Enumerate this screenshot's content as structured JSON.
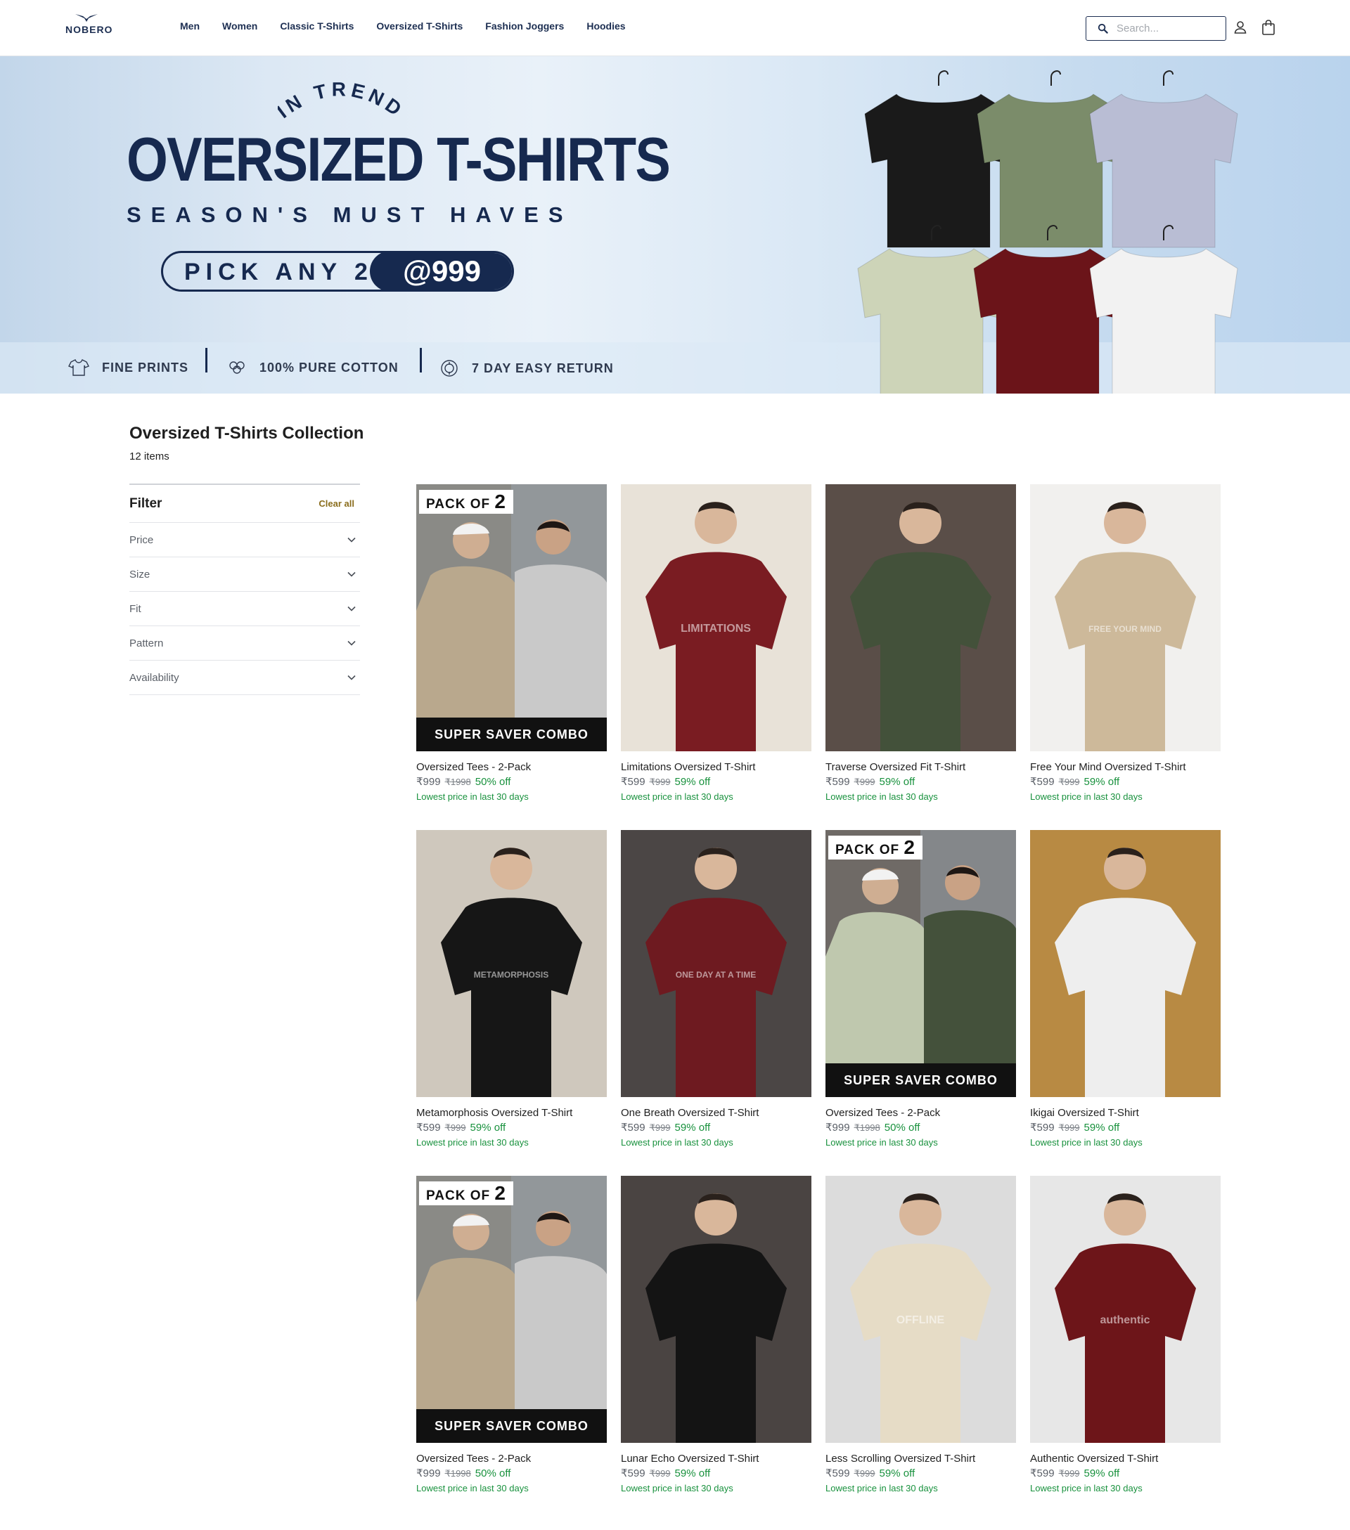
{
  "header": {
    "logo_text": "NOBERO",
    "nav": [
      "Men",
      "Women",
      "Classic T-Shirts",
      "Oversized T-Shirts",
      "Fashion Joggers",
      "Hoodies"
    ],
    "search_placeholder": "Search...",
    "icons": [
      "search-icon",
      "user-icon",
      "bag-icon"
    ]
  },
  "hero": {
    "kicker": "IN TREND",
    "title": "OVERSIZED T-SHIRTS",
    "subtitle": "SEASON'S MUST HAVES",
    "offer_left": "PICK ANY 2",
    "offer_right": "@999",
    "features": [
      "FINE PRINTS",
      "100% PURE COTTON",
      "7 DAY EASY RETURN"
    ],
    "shirt_colors": [
      "#1a1a1a",
      "#7b8c6a",
      "#b9bdd4",
      "#cdd4b8",
      "#6b1419",
      "#f2f2f2"
    ]
  },
  "collection": {
    "title": "Oversized T-Shirts Collection",
    "count": "12 items"
  },
  "filter": {
    "title": "Filter",
    "clear": "Clear all",
    "items": [
      "Price",
      "Size",
      "Fit",
      "Pattern",
      "Availability"
    ]
  },
  "products": [
    {
      "name": "Oversized Tees - 2-Pack",
      "price": "₹999",
      "mrp": "₹1998",
      "off": "50% off",
      "note": "Lowest price in last 30 days",
      "pack": true,
      "combo": "SUPER SAVER COMBO",
      "badge": "PACK OF",
      "badge_num": "2",
      "colors": [
        "#b9a88d",
        "#c9c9c9"
      ],
      "bg": "#8a8a86"
    },
    {
      "name": "Limitations Oversized T-Shirt",
      "price": "₹599",
      "mrp": "₹999",
      "off": "59% off",
      "note": "Lowest price in last 30 days",
      "shirt": "#7a1c22",
      "bg": "#e8e2d8",
      "print": "LIMITATIONS"
    },
    {
      "name": "Traverse Oversized Fit T-Shirt",
      "price": "₹599",
      "mrp": "₹999",
      "off": "59% off",
      "note": "Lowest price in last 30 days",
      "shirt": "#43513a",
      "bg": "#5a4e48"
    },
    {
      "name": "Free Your Mind Oversized T-Shirt",
      "price": "₹599",
      "mrp": "₹999",
      "off": "59% off",
      "note": "Lowest price in last 30 days",
      "shirt": "#cdb99a",
      "bg": "#f1f0ee",
      "print": "FREE YOUR MIND"
    },
    {
      "name": "Metamorphosis Oversized T-Shirt",
      "price": "₹599",
      "mrp": "₹999",
      "off": "59% off",
      "note": "Lowest price in last 30 days",
      "shirt": "#161616",
      "bg": "#cfc8bd",
      "print": "METAMORPHOSIS"
    },
    {
      "name": "One Breath Oversized T-Shirt",
      "price": "₹599",
      "mrp": "₹999",
      "off": "59% off",
      "note": "Lowest price in last 30 days",
      "shirt": "#6e1a20",
      "bg": "#4b4645",
      "print": "ONE DAY AT A TIME"
    },
    {
      "name": "Oversized Tees - 2-Pack",
      "price": "₹999",
      "mrp": "₹1998",
      "off": "50% off",
      "note": "Lowest price in last 30 days",
      "pack": true,
      "combo": "SUPER SAVER COMBO",
      "badge": "PACK OF",
      "badge_num": "2",
      "colors": [
        "#bfc8ae",
        "#44513b"
      ],
      "bg": "#6f6a66"
    },
    {
      "name": "Ikigai Oversized T-Shirt",
      "price": "₹599",
      "mrp": "₹999",
      "off": "59% off",
      "note": "Lowest price in last 30 days",
      "shirt": "#eeeeee",
      "bg": "#b88a43"
    },
    {
      "name": "Oversized Tees - 2-Pack",
      "price": "₹999",
      "mrp": "₹1998",
      "off": "50% off",
      "note": "Lowest price in last 30 days",
      "pack": true,
      "combo": "SUPER SAVER COMBO",
      "badge": "PACK OF",
      "badge_num": "2",
      "colors": [
        "#b9a88d",
        "#c9c9c9"
      ],
      "bg": "#8a8a86"
    },
    {
      "name": "Lunar Echo Oversized T-Shirt",
      "price": "₹599",
      "mrp": "₹999",
      "off": "59% off",
      "note": "Lowest price in last 30 days",
      "shirt": "#141414",
      "bg": "#4a4442"
    },
    {
      "name": "Less Scrolling Oversized T-Shirt",
      "price": "₹599",
      "mrp": "₹999",
      "off": "59% off",
      "note": "Lowest price in last 30 days",
      "shirt": "#e6dcc6",
      "bg": "#dcdcdc",
      "print": "OFFLINE"
    },
    {
      "name": "Authentic Oversized T-Shirt",
      "price": "₹599",
      "mrp": "₹999",
      "off": "59% off",
      "note": "Lowest price in last 30 days",
      "shirt": "#6d1519",
      "bg": "#e7e7e7",
      "print": "authentic"
    }
  ]
}
